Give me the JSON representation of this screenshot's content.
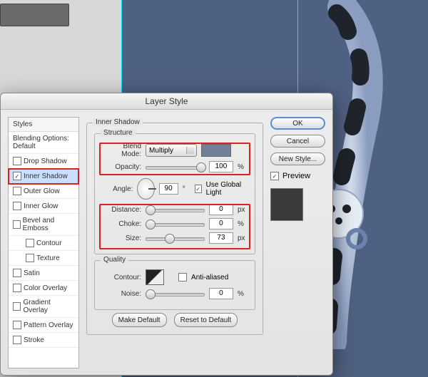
{
  "dialog": {
    "title": "Layer Style"
  },
  "sidebar": {
    "head": "Styles",
    "items": [
      {
        "label": "Blending Options: Default",
        "cb": false,
        "checked": false,
        "sub": false,
        "sel": false
      },
      {
        "label": "Drop Shadow",
        "cb": true,
        "checked": false,
        "sub": false,
        "sel": false
      },
      {
        "label": "Inner Shadow",
        "cb": true,
        "checked": true,
        "sub": false,
        "sel": true
      },
      {
        "label": "Outer Glow",
        "cb": true,
        "checked": false,
        "sub": false,
        "sel": false
      },
      {
        "label": "Inner Glow",
        "cb": true,
        "checked": false,
        "sub": false,
        "sel": false
      },
      {
        "label": "Bevel and Emboss",
        "cb": true,
        "checked": false,
        "sub": false,
        "sel": false
      },
      {
        "label": "Contour",
        "cb": true,
        "checked": false,
        "sub": true,
        "sel": false
      },
      {
        "label": "Texture",
        "cb": true,
        "checked": false,
        "sub": true,
        "sel": false
      },
      {
        "label": "Satin",
        "cb": true,
        "checked": false,
        "sub": false,
        "sel": false
      },
      {
        "label": "Color Overlay",
        "cb": true,
        "checked": false,
        "sub": false,
        "sel": false
      },
      {
        "label": "Gradient Overlay",
        "cb": true,
        "checked": false,
        "sub": false,
        "sel": false
      },
      {
        "label": "Pattern Overlay",
        "cb": true,
        "checked": false,
        "sub": false,
        "sel": false
      },
      {
        "label": "Stroke",
        "cb": true,
        "checked": false,
        "sub": false,
        "sel": false
      }
    ]
  },
  "panel": {
    "title": "Inner Shadow",
    "structure": {
      "legend": "Structure",
      "blend_label": "Blend Mode:",
      "blend_value": "Multiply",
      "opacity_label": "Opacity:",
      "opacity_value": "100",
      "pct": "%",
      "angle_label": "Angle:",
      "angle_value": "90",
      "deg": "°",
      "ugl_label": "Use Global Light",
      "distance_label": "Distance:",
      "distance_value": "0",
      "choke_label": "Choke:",
      "choke_value": "0",
      "size_label": "Size:",
      "size_value": "73",
      "px": "px"
    },
    "quality": {
      "legend": "Quality",
      "contour_label": "Contour:",
      "aa_label": "Anti-aliased",
      "noise_label": "Noise:",
      "noise_value": "0",
      "pct": "%"
    },
    "make_default": "Make Default",
    "reset_default": "Reset to Default"
  },
  "buttons": {
    "ok": "OK",
    "cancel": "Cancel",
    "newstyle": "New Style...",
    "preview": "Preview"
  }
}
